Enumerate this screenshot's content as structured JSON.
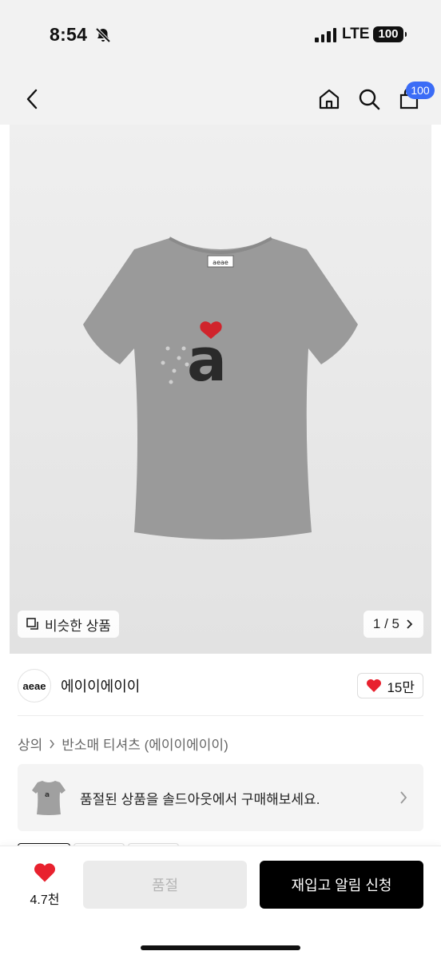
{
  "status_bar": {
    "time": "8:54",
    "network": "LTE",
    "battery": "100"
  },
  "nav": {
    "cart_count": "100"
  },
  "product_image": {
    "similar_label": "비슷한 상품",
    "page_indicator": "1 / 5",
    "neck_label": "aeae"
  },
  "brand": {
    "logo_text": "aeae",
    "name": "에이이에이이",
    "likes": "15만"
  },
  "breadcrumb": {
    "items": [
      "상의",
      "반소매 티셔츠 (에이이에이이)"
    ]
  },
  "soldout_banner": {
    "text": "품절된 상품을 솔드아웃에서 구매해보세요."
  },
  "bottom_bar": {
    "wish_count": "4.7천",
    "soldout_label": "품절",
    "restock_label": "재입고 알림 신청"
  },
  "colors": {
    "accent": "#3b6cf6",
    "heart": "#e8212e",
    "shirt": "#9a9a9a"
  }
}
